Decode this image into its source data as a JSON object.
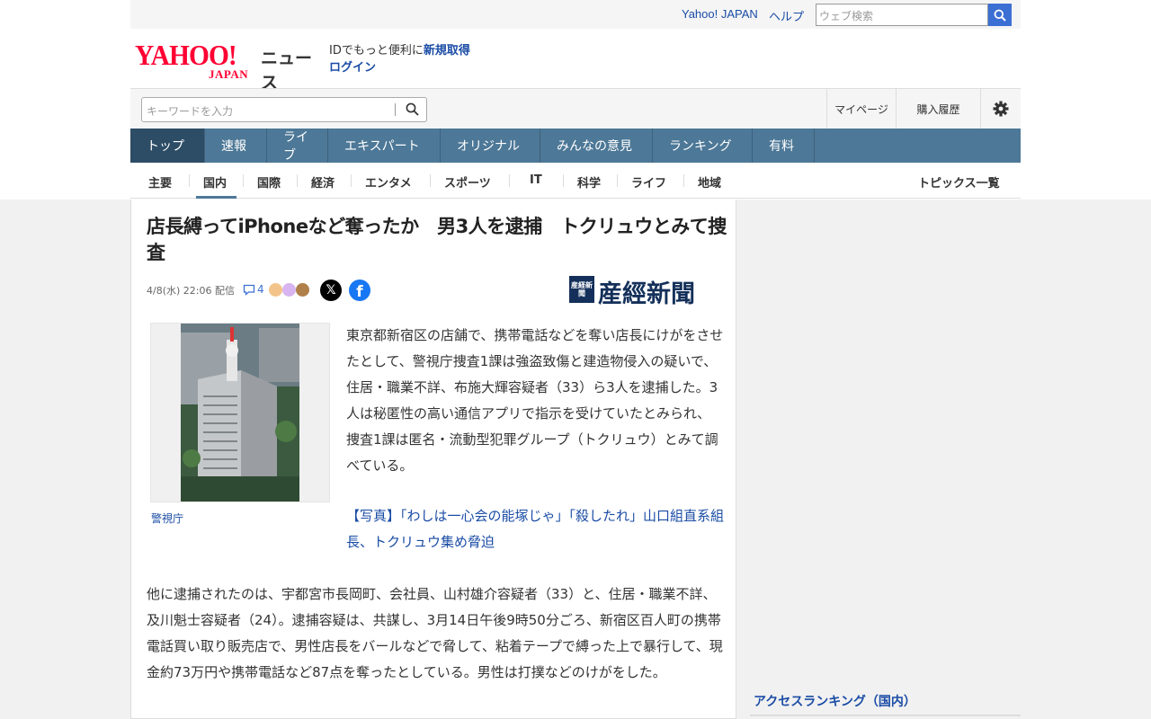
{
  "util": {
    "links": [
      "Yahoo! JAPAN",
      "ヘルプ"
    ],
    "search_placeholder": "ウェブ検索"
  },
  "header": {
    "logo_text": "YAHOO!",
    "logo_sub": "JAPAN",
    "service_name": "ニュース",
    "login_prompt": "IDでもっと便利に",
    "register_label": "新規取得",
    "login_label": "ログイン"
  },
  "search": {
    "placeholder": "キーワードを入力",
    "mypage_label": "マイページ",
    "history_label": "購入履歴"
  },
  "nav": {
    "tabs": [
      "トップ",
      "速報",
      "ライブ",
      "エキスパート",
      "オリジナル",
      "みんなの意見",
      "ランキング",
      "有料"
    ]
  },
  "subnav": {
    "items": [
      "主要",
      "国内",
      "国際",
      "経済",
      "エンタメ",
      "スポーツ",
      "IT",
      "科学",
      "ライフ",
      "地域"
    ],
    "active": "国内",
    "topics_label": "トピックス一覧"
  },
  "article": {
    "title": "店長縛ってiPhoneなど奪ったか　男3人を逮捕　トクリュウとみて捜査",
    "date": "4/8(水) 22:06",
    "delivered": "配信",
    "comment_count": "4",
    "publisher": "産經新聞",
    "publisher_box": "産経新聞",
    "photo_caption": "警視庁",
    "lead": "東京都新宿区の店舗で、携帯電話などを奪い店長にけがをさせたとして、警視庁捜査1課は強盗致傷と建造物侵入の疑いで、住居・職業不詳、布施大輝容疑者（33）ら3人を逮捕した。3人は秘匿性の高い通信アプリで指示を受けていたとみられ、捜査1課は匿名・流動型犯罪グループ（トクリュウ）とみて調べている。",
    "related_link": "【写真】「わしは一心会の能塚じゃ」「殺したれ」山口組直系組長、トクリュウ集め脅迫",
    "body": "他に逮捕されたのは、宇都宮市長岡町、会社員、山村雄介容疑者（33）と、住居・職業不詳、及川魁士容疑者（24）。逮捕容疑は、共謀し、3月14日午後9時50分ごろ、新宿区百人町の携帯電話買い取り販売店で、男性店長をバールなどで脅して、粘着テープで縛った上で暴行して、現金約73万円や携帯電話など87点を奪ったとしている。男性は打撲などのけがをした。"
  },
  "sidebar": {
    "ranking_title": "アクセスランキング（国内）"
  },
  "colors": {
    "nav_bg": "#4d7897",
    "nav_active": "#2d4d66",
    "link": "#1a4ca5",
    "brand_red": "#ff0033",
    "search_button": "#3c6fd4"
  },
  "icons": [
    "search-icon",
    "gear-icon",
    "comment-icon",
    "x-share-icon",
    "facebook-share-icon"
  ]
}
